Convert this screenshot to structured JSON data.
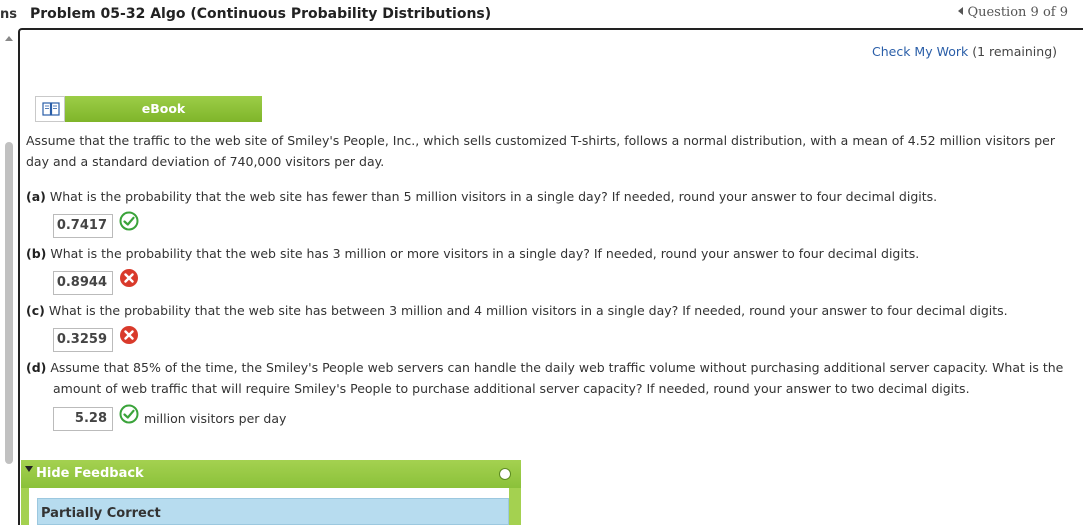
{
  "left_edge_label": "ns",
  "header": {
    "title": "Problem 05-32 Algo (Continuous Probability Distributions)",
    "question_nav": "Question 9 of 9"
  },
  "check_work": {
    "link": "Check My Work",
    "remaining": "(1 remaining)"
  },
  "ebook": {
    "label": "eBook"
  },
  "stem": "Assume that the traffic to the web site of Smiley's People, Inc., which sells customized T-shirts, follows a normal distribution, with a mean of 4.52 million visitors per day and a standard deviation of 740,000 visitors per day.",
  "questions": [
    {
      "tag": "(a)",
      "text": "What is the probability that the web site has fewer than 5 million visitors in a single day? If needed, round your answer to four decimal digits.",
      "answer": "0.7417",
      "status": "correct"
    },
    {
      "tag": "(b)",
      "text": "What is the probability that the web site has 3 million or more visitors in a single day? If needed, round your answer to four decimal digits.",
      "answer": "0.8944",
      "status": "incorrect"
    },
    {
      "tag": "(c)",
      "text": "What is the probability that the web site has between 3 million and 4 million visitors in a single day? If needed, round your answer to four decimal digits.",
      "answer": "0.3259",
      "status": "incorrect"
    },
    {
      "tag": "(d)",
      "text_line1": "Assume that 85% of the time, the Smiley's People web servers can handle the daily web traffic volume without purchasing additional server capacity. What is the",
      "text_line2": "amount of web traffic that will require Smiley's People to purchase additional server capacity? If needed, round your answer to two decimal digits.",
      "answer": "5.28",
      "status": "correct",
      "unit": "million visitors per day"
    }
  ],
  "feedback": {
    "toggle_label": "Hide Feedback",
    "result": "Partially Correct"
  },
  "colors": {
    "green_bar": "#8bc13a",
    "correct": "#3aa33a",
    "incorrect": "#d93a2b",
    "link": "#2a5ea8",
    "feedback_box": "#b7dcef"
  }
}
